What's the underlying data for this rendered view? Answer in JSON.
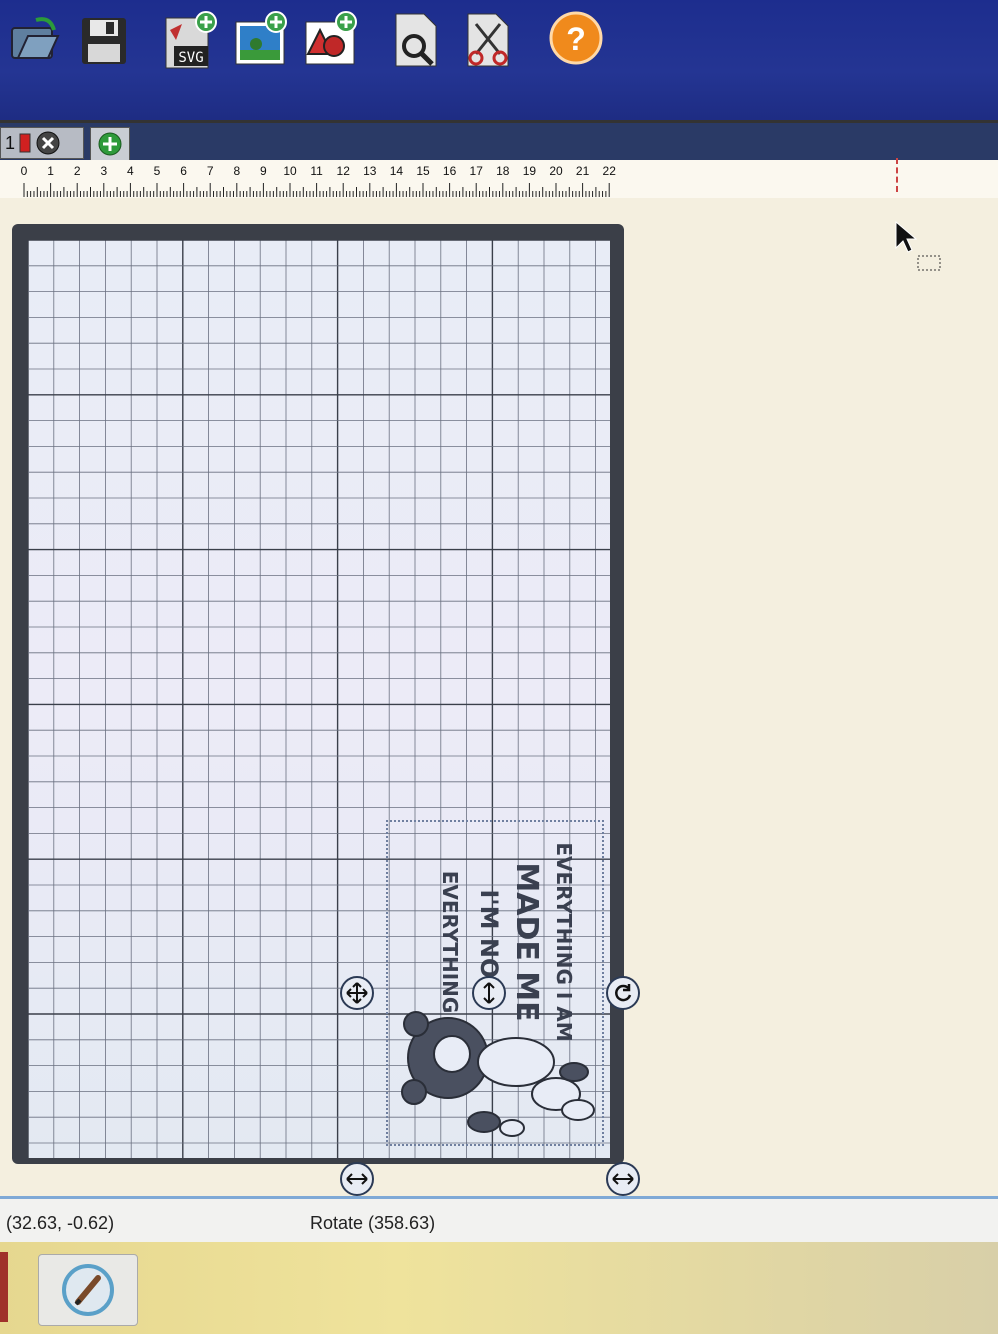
{
  "toolbar": {
    "buttons": [
      {
        "name": "open-file-button",
        "icon": "open-folder-icon"
      },
      {
        "name": "save-button",
        "icon": "floppy-disk-icon"
      },
      {
        "name": "import-svg-button",
        "icon": "import-svg-icon",
        "label": "SVG"
      },
      {
        "name": "import-image-button",
        "icon": "import-image-icon"
      },
      {
        "name": "add-shapes-button",
        "icon": "shapes-icon"
      },
      {
        "name": "preview-button",
        "icon": "magnifier-page-icon"
      },
      {
        "name": "cut-button",
        "icon": "scissors-page-icon"
      },
      {
        "name": "help-button",
        "icon": "help-icon",
        "label": "?"
      }
    ]
  },
  "tabs": {
    "page_number": "1",
    "add_icon": "plus-icon"
  },
  "ruler": {
    "ticks": [
      "0",
      "1",
      "2",
      "3",
      "4",
      "5",
      "6",
      "7",
      "8",
      "9",
      "10",
      "11",
      "12",
      "13",
      "14",
      "15",
      "16",
      "17",
      "18",
      "19",
      "20",
      "21",
      "22"
    ]
  },
  "design": {
    "text_lines": [
      "EVERYTHING I AM",
      "MADE ME",
      "I'M NOT",
      "EVERYTHING"
    ]
  },
  "status": {
    "position_text": "; (32.63, -0.62)",
    "rotate_text": "Rotate (358.63)"
  },
  "colors": {
    "toolbar_bg": "#1e2c83",
    "mat_border": "#3b3f48",
    "status_border": "#7fa9d6",
    "help_orange": "#f08a1c"
  }
}
